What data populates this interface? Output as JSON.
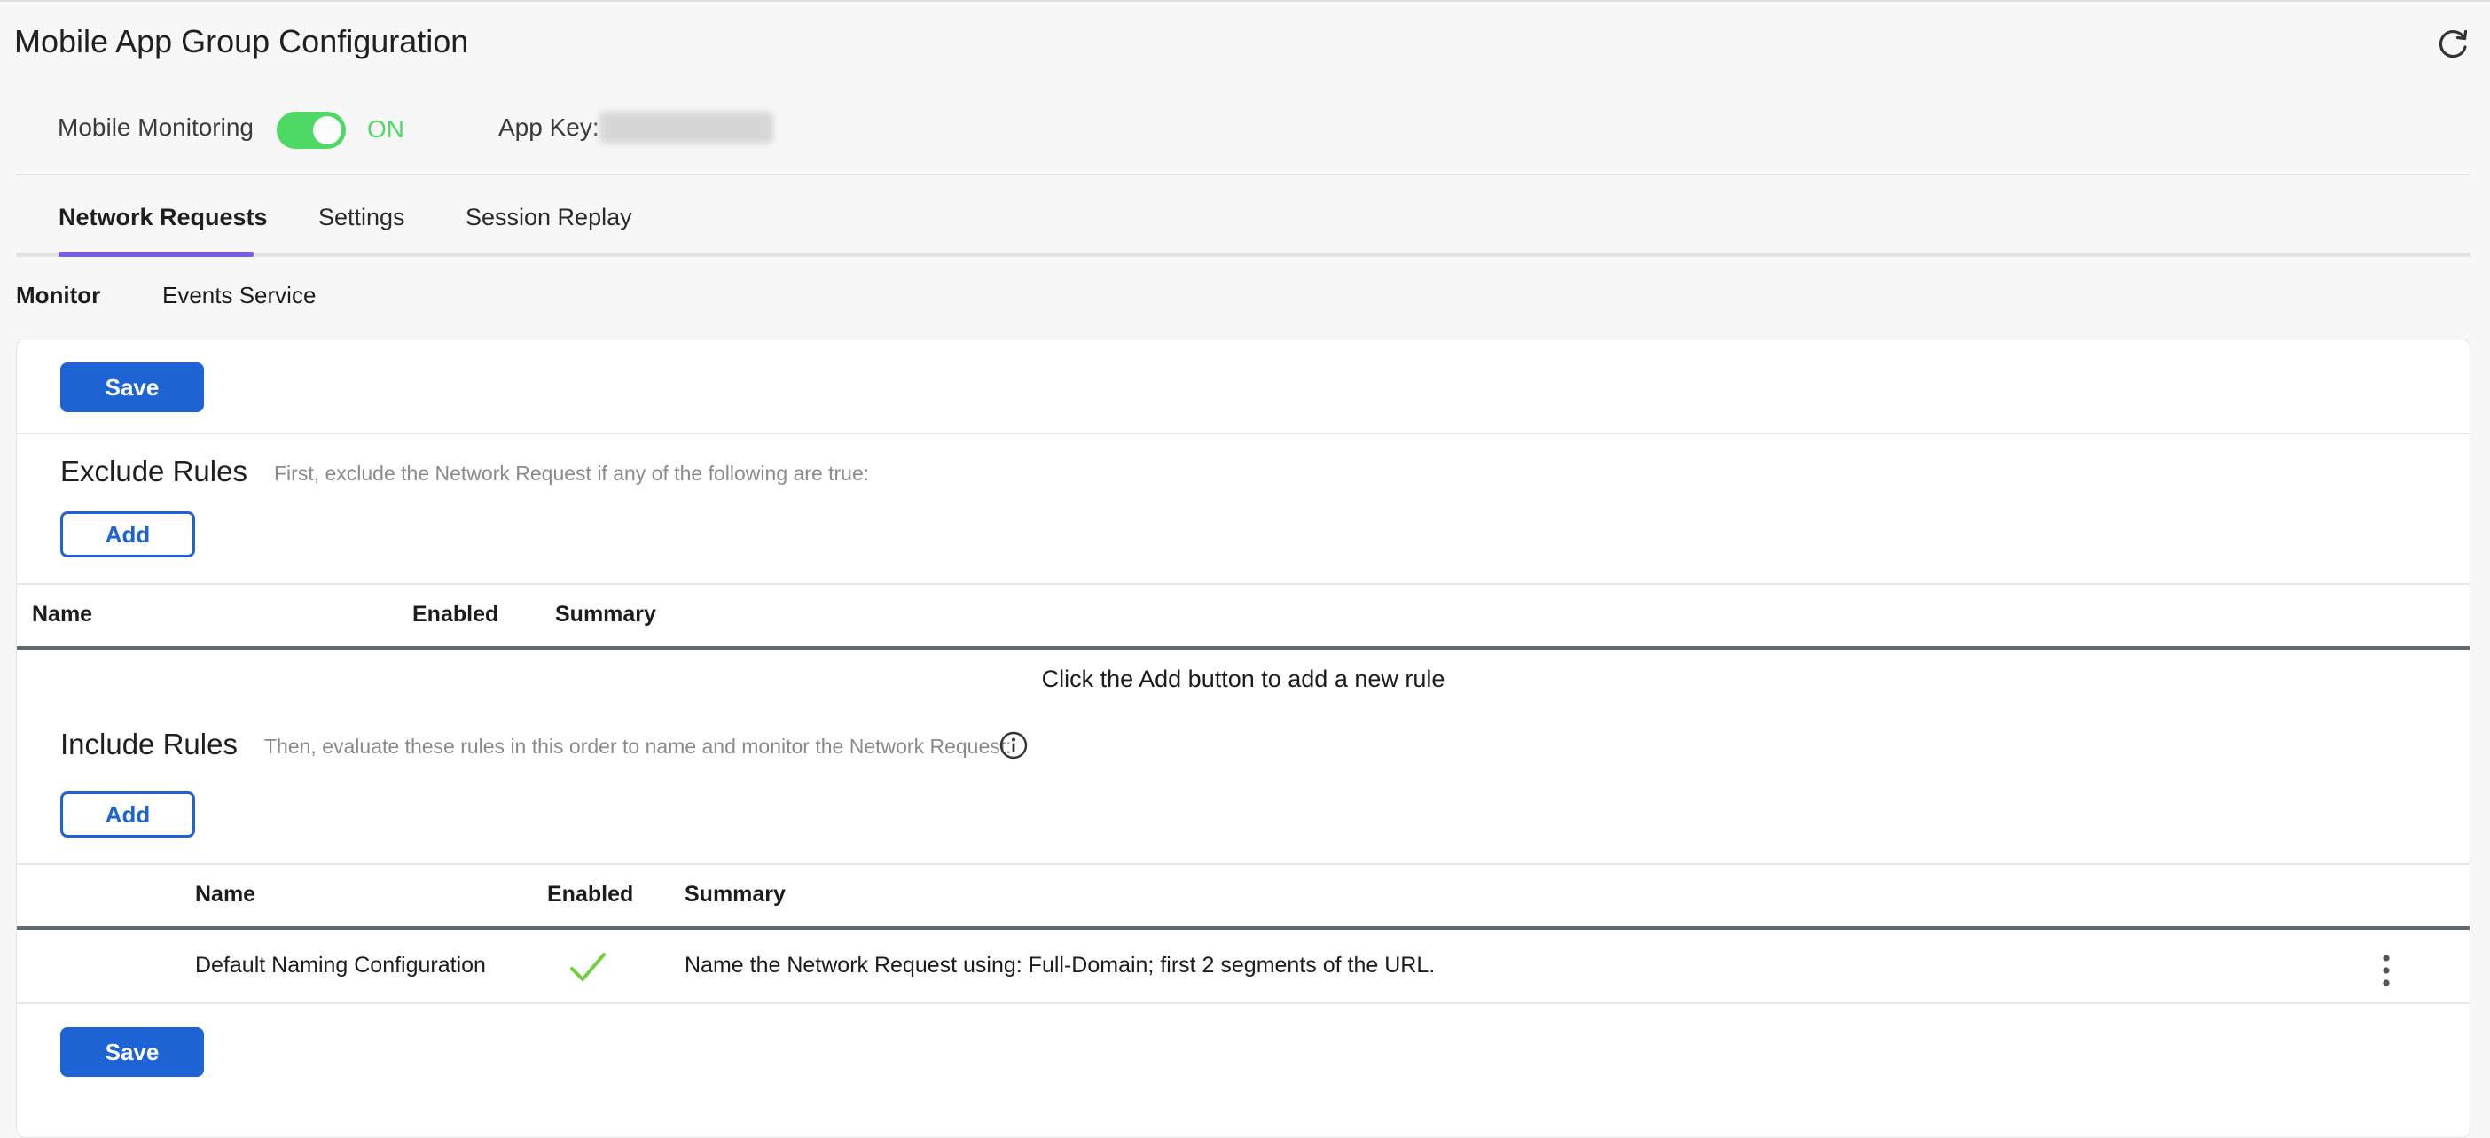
{
  "page": {
    "title": "Mobile App Group Configuration"
  },
  "monitoring": {
    "label": "Mobile Monitoring",
    "state": "ON",
    "app_key_label": "App Key:"
  },
  "tabs": [
    {
      "label": "Network Requests",
      "active": true
    },
    {
      "label": "Settings",
      "active": false
    },
    {
      "label": "Session Replay",
      "active": false
    }
  ],
  "subtabs": [
    {
      "label": "Monitor",
      "active": true
    },
    {
      "label": "Events Service",
      "active": false
    }
  ],
  "buttons": {
    "save": "Save",
    "add": "Add"
  },
  "exclude": {
    "title": "Exclude Rules",
    "description": "First, exclude the Network Request if any of the following are true:",
    "columns": [
      "Name",
      "Enabled",
      "Summary"
    ],
    "empty_message": "Click the Add button to add a new rule"
  },
  "include": {
    "title": "Include Rules",
    "description": "Then, evaluate these rules in this order to name and monitor the Network Request:",
    "columns": [
      "Name",
      "Enabled",
      "Summary"
    ],
    "rows": [
      {
        "name": "Default Naming Configuration",
        "enabled": true,
        "summary": "Name the Network Request using: Full-Domain; first 2 segments of the URL."
      }
    ]
  },
  "colors": {
    "accent": "#1d63d3",
    "toggle_on": "#4cd964",
    "tab_indicator": "#7b5ce5",
    "check": "#6fcf3f"
  },
  "icons": {
    "refresh": "refresh-icon",
    "info": "info-icon",
    "check": "check-icon",
    "more": "kebab-menu-icon"
  }
}
